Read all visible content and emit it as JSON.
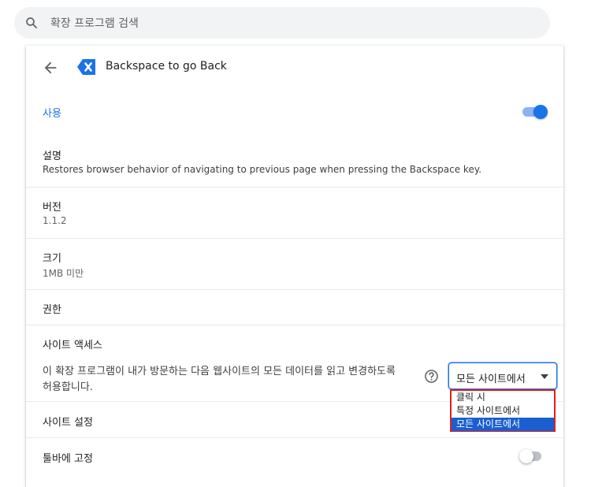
{
  "search": {
    "placeholder": "확장 프로그램 검색"
  },
  "header": {
    "extension_name": "Backspace to go Back"
  },
  "enabled": {
    "label": "사용",
    "on": true
  },
  "description": {
    "label": "설명",
    "text": "Restores browser behavior of navigating to previous page when pressing the Backspace key."
  },
  "version": {
    "label": "버전",
    "value": "1.1.2"
  },
  "size": {
    "label": "크기",
    "value": "1MB 미만"
  },
  "permissions": {
    "label": "권한"
  },
  "site_access": {
    "label": "사이트 액세스",
    "description_line1": "이 확장 프로그램이 내가 방문하는 다음 웹사이트의 모든 데이터를 읽고 변경하도록",
    "description_line2": "허용합니다.",
    "selected": "모든 사이트에서",
    "options": [
      "클릭 시",
      "특정 사이트에서",
      "모든 사이트에서"
    ]
  },
  "site_settings": {
    "label": "사이트 설정"
  },
  "pin_toolbar": {
    "label": "툴바에 고정",
    "on": false
  },
  "colors": {
    "accent": "#1a73e8",
    "toggle_track_on": "#8ab4f8",
    "dropdown_highlight": "#1a5fd0",
    "outline": "#e0201c"
  },
  "icons": {
    "search": "search-icon",
    "back": "arrow-back-icon",
    "logo": "extension-logo-icon",
    "help": "help-icon"
  }
}
